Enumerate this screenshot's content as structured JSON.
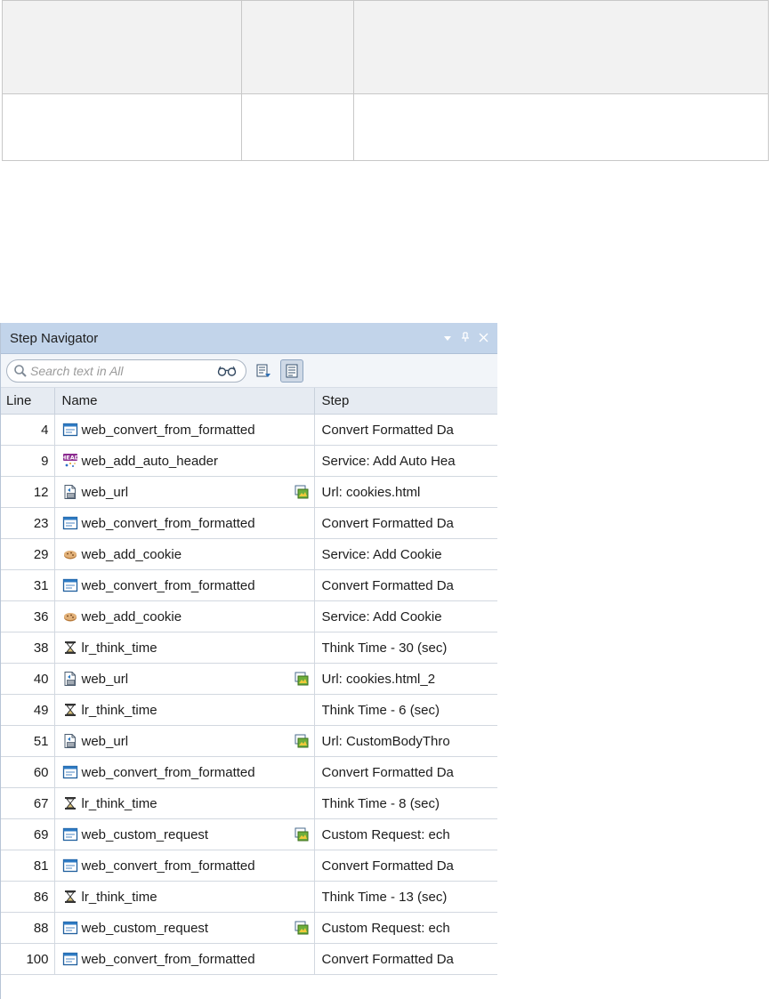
{
  "panel": {
    "title": "Step Navigator",
    "search_placeholder": "Search text in All"
  },
  "columns": [
    "Line",
    "Name",
    "Step"
  ],
  "rows": [
    {
      "line": "4",
      "icon": "web-window-icon",
      "name": "web_convert_from_formatted",
      "snapshot": false,
      "step": "Convert Formatted Da"
    },
    {
      "line": "9",
      "icon": "header-icon",
      "name": "web_add_auto_header",
      "snapshot": false,
      "step": "Service: Add Auto Hea"
    },
    {
      "line": "12",
      "icon": "url-icon",
      "name": "web_url",
      "snapshot": true,
      "step": "Url: cookies.html"
    },
    {
      "line": "23",
      "icon": "web-window-icon",
      "name": "web_convert_from_formatted",
      "snapshot": false,
      "step": "Convert Formatted Da"
    },
    {
      "line": "29",
      "icon": "cookie-icon",
      "name": "web_add_cookie",
      "snapshot": false,
      "step": "Service: Add Cookie"
    },
    {
      "line": "31",
      "icon": "web-window-icon",
      "name": "web_convert_from_formatted",
      "snapshot": false,
      "step": "Convert Formatted Da"
    },
    {
      "line": "36",
      "icon": "cookie-icon",
      "name": "web_add_cookie",
      "snapshot": false,
      "step": "Service: Add Cookie"
    },
    {
      "line": "38",
      "icon": "hourglass-icon",
      "name": "lr_think_time",
      "snapshot": false,
      "step": "Think Time - 30 (sec)"
    },
    {
      "line": "40",
      "icon": "url-icon",
      "name": "web_url",
      "snapshot": true,
      "step": "Url: cookies.html_2"
    },
    {
      "line": "49",
      "icon": "hourglass-icon",
      "name": "lr_think_time",
      "snapshot": false,
      "step": "Think Time - 6 (sec)"
    },
    {
      "line": "51",
      "icon": "url-icon",
      "name": "web_url",
      "snapshot": true,
      "step": "Url: CustomBodyThro"
    },
    {
      "line": "60",
      "icon": "web-window-icon",
      "name": "web_convert_from_formatted",
      "snapshot": false,
      "step": "Convert Formatted Da"
    },
    {
      "line": "67",
      "icon": "hourglass-icon",
      "name": "lr_think_time",
      "snapshot": false,
      "step": "Think Time - 8 (sec)"
    },
    {
      "line": "69",
      "icon": "web-window-icon",
      "name": "web_custom_request",
      "snapshot": true,
      "step": "Custom Request: ech"
    },
    {
      "line": "81",
      "icon": "web-window-icon",
      "name": "web_convert_from_formatted",
      "snapshot": false,
      "step": "Convert Formatted Da"
    },
    {
      "line": "86",
      "icon": "hourglass-icon",
      "name": "lr_think_time",
      "snapshot": false,
      "step": "Think Time - 13 (sec)"
    },
    {
      "line": "88",
      "icon": "web-window-icon",
      "name": "web_custom_request",
      "snapshot": true,
      "step": "Custom Request: ech"
    },
    {
      "line": "100",
      "icon": "web-window-icon",
      "name": "web_convert_from_formatted",
      "snapshot": false,
      "step": "Convert Formatted Da"
    }
  ]
}
